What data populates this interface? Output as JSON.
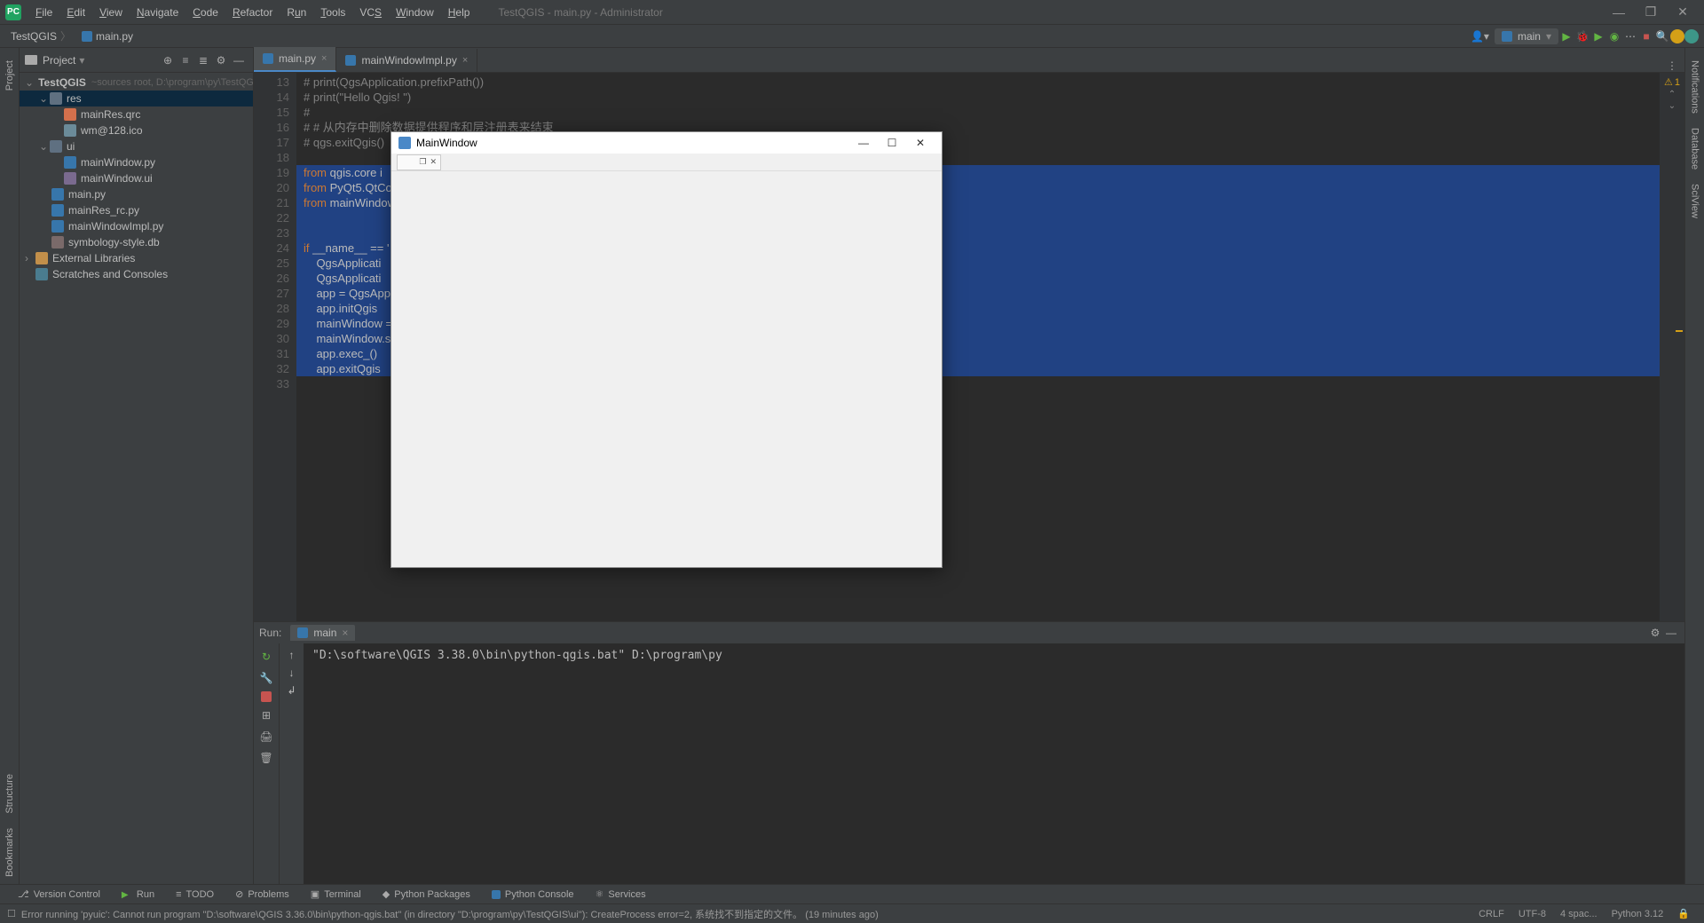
{
  "titlebar": {
    "menus": [
      "File",
      "Edit",
      "View",
      "Navigate",
      "Code",
      "Refactor",
      "Run",
      "Tools",
      "VCS",
      "Window",
      "Help"
    ],
    "title": "TestQGIS - main.py - Administrator"
  },
  "navbar": {
    "crumbs": [
      "TestQGIS",
      "main.py"
    ],
    "run_config": "main",
    "user_icon": "▾"
  },
  "project": {
    "header": "Project",
    "root_name": "TestQGIS",
    "root_hint": "~sources root, D:\\program\\py\\TestQGIS",
    "res": "res",
    "res_files": [
      "mainRes.qrc",
      "wm@128.ico"
    ],
    "ui": "ui",
    "ui_files": [
      "mainWindow.py",
      "mainWindow.ui"
    ],
    "root_files": [
      "main.py",
      "mainRes_rc.py",
      "mainWindowImpl.py",
      "symbology-style.db"
    ],
    "ext_lib": "External Libraries",
    "scratches": "Scratches and Consoles"
  },
  "tabs": {
    "t1": "main.py",
    "t2": "mainWindowImpl.py"
  },
  "code": {
    "lines": [
      {
        "n": 13,
        "t": "# print(QgsApplication.prefixPath())",
        "cls": "cmt"
      },
      {
        "n": 14,
        "t": "# print(\"Hello Qgis! \")",
        "cls": "cmt"
      },
      {
        "n": 15,
        "t": "#",
        "cls": "cmt"
      },
      {
        "n": 16,
        "t": "# # 从内存中删除数据提供程序和层注册表来结束",
        "cls": "cmt"
      },
      {
        "n": 17,
        "t": "# qgs.exitQgis()",
        "cls": "cmt"
      },
      {
        "n": 18,
        "t": "",
        "cls": ""
      },
      {
        "n": 19,
        "t": "from qgis.core i",
        "cls": "",
        "sel": true,
        "kw": "from"
      },
      {
        "n": 20,
        "t": "from PyQt5.QtCor",
        "cls": "",
        "sel": true,
        "kw": "from"
      },
      {
        "n": 21,
        "t": "from mainWindowI",
        "cls": "",
        "sel": true,
        "kw": "from"
      },
      {
        "n": 22,
        "t": "",
        "cls": "",
        "sel": true
      },
      {
        "n": 23,
        "t": "",
        "cls": "",
        "sel": true
      },
      {
        "n": 24,
        "t": "if __name__ == '",
        "cls": "",
        "sel": true,
        "kw": "if",
        "mark": "▶"
      },
      {
        "n": 25,
        "t": "    QgsApplicati",
        "cls": "",
        "sel": true
      },
      {
        "n": 26,
        "t": "    QgsApplicati",
        "cls": "",
        "sel": true
      },
      {
        "n": 27,
        "t": "    app = QgsApp",
        "cls": "",
        "sel": true
      },
      {
        "n": 28,
        "t": "    app.initQgis",
        "cls": "",
        "sel": true
      },
      {
        "n": 29,
        "t": "    mainWindow =",
        "cls": "",
        "sel": true
      },
      {
        "n": 30,
        "t": "    mainWindow.s",
        "cls": "",
        "sel": true
      },
      {
        "n": 31,
        "t": "    app.exec_()",
        "cls": "",
        "sel": true
      },
      {
        "n": 32,
        "t": "    app.exitQgis",
        "cls": "",
        "sel": true
      },
      {
        "n": 33,
        "t": "",
        "cls": ""
      }
    ]
  },
  "inspection": {
    "warn_count": "1"
  },
  "run": {
    "label": "Run:",
    "tab": "main",
    "output": "\"D:\\software\\QGIS 3.38.0\\bin\\python-qgis.bat\" D:\\program\\py"
  },
  "bottom": {
    "version_control": "Version Control",
    "run": "Run",
    "todo": "TODO",
    "problems": "Problems",
    "terminal": "Terminal",
    "python_packages": "Python Packages",
    "python_console": "Python Console",
    "services": "Services"
  },
  "status": {
    "error": "Error running 'pyuic': Cannot run program \"D:\\software\\QGIS 3.36.0\\bin\\python-qgis.bat\" (in directory \"D:\\program\\py\\TestQGIS\\ui\"): CreateProcess error=2, 系统找不到指定的文件。 (19 minutes ago)",
    "crlf": "CRLF",
    "encoding": "UTF-8",
    "indent": "4 spac...",
    "python": "Python 3.12"
  },
  "left_rail": {
    "project": "Project",
    "structure": "Structure",
    "bookmarks": "Bookmarks"
  },
  "right_rail": {
    "notifications": "Notifications",
    "database": "Database",
    "sciview": "SciView"
  },
  "popup": {
    "title": "MainWindow"
  }
}
